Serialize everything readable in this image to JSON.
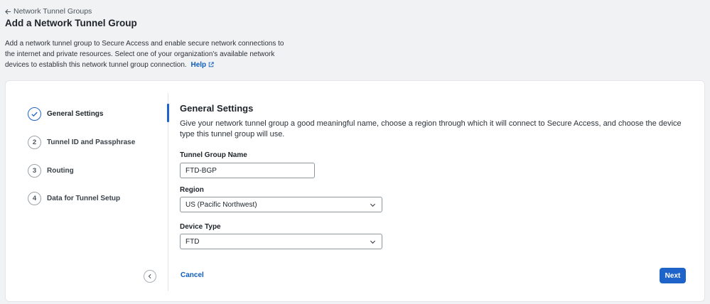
{
  "header": {
    "back_label": "Network Tunnel Groups",
    "title": "Add a Network Tunnel Group",
    "intro_text": "Add a network tunnel group to Secure Access and enable secure network connections to the internet and private resources. Select one of your organization's available network devices to establish this network tunnel group connection.",
    "help_label": "Help"
  },
  "steps": [
    {
      "number": "",
      "label": "General Settings",
      "state": "completed-active"
    },
    {
      "number": "2",
      "label": "Tunnel ID and Passphrase"
    },
    {
      "number": "3",
      "label": "Routing"
    },
    {
      "number": "4",
      "label": "Data for Tunnel Setup"
    }
  ],
  "form": {
    "section_title": "General Settings",
    "section_desc": "Give your network tunnel group a good meaningful name, choose a region through which it will connect to Secure Access, and choose the device type this tunnel group will use.",
    "name_label": "Tunnel Group Name",
    "name_value": "FTD-BGP",
    "region_label": "Region",
    "region_value": "US (Pacific Northwest)",
    "device_label": "Device Type",
    "device_value": "FTD"
  },
  "actions": {
    "cancel_label": "Cancel",
    "next_label": "Next"
  },
  "colors": {
    "accent": "#1e63c9",
    "link": "#0d5cbc",
    "background": "#f1f2f4"
  }
}
